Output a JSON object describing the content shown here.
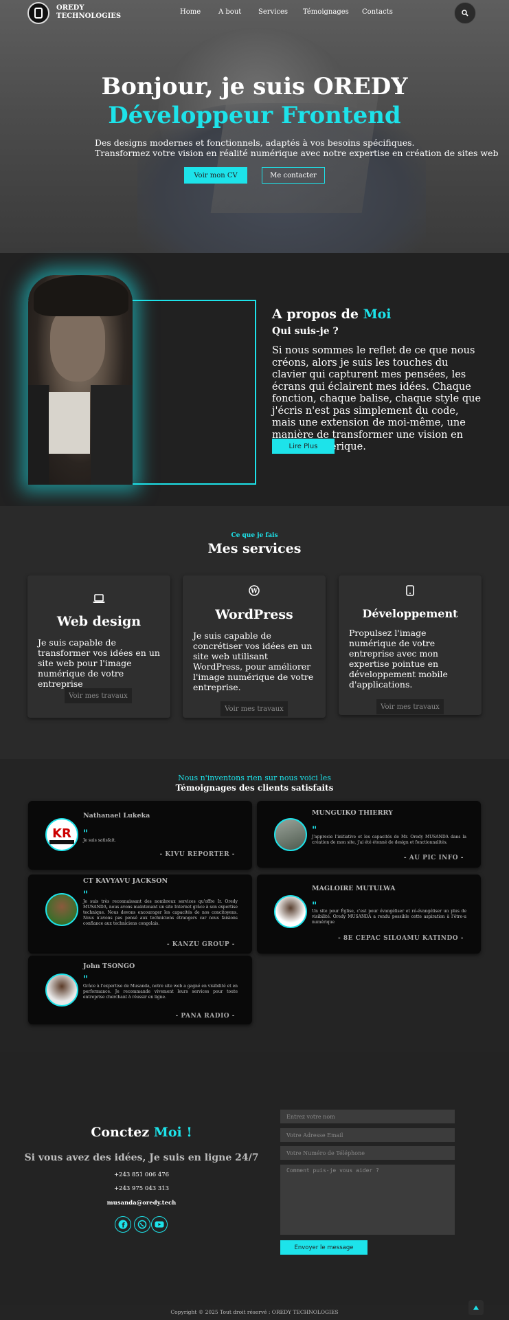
{
  "header": {
    "logo_text_line1": "OREDY",
    "logo_text_line2": "TECHNOLOGIES",
    "nav": [
      "Home",
      "A bout",
      "Services",
      "Témoignages",
      "Contacts"
    ]
  },
  "hero": {
    "greeting": "Bonjour, je suis OREDY",
    "role": "Développeur Frontend",
    "line1": "Des designs modernes et fonctionnels, adaptés à vos besoins spécifiques.",
    "line2": "Transformez votre vision en réalité numérique avec notre expertise en création de sites web",
    "btn_cv": "Voir mon CV",
    "btn_contact": "Me contacter"
  },
  "about": {
    "title_prefix": "A propos de",
    "title_accent": "Moi",
    "subtitle": "Qui suis-je ?",
    "text": "Si nous sommes le reflet de ce que nous créons, alors je suis les touches du clavier qui capturent mes pensées, les écrans qui éclairent mes idées. Chaque fonction, chaque balise, chaque style que j'écris n'est pas simplement du code, mais une extension de moi-même, une manière de transformer une vision en réalité numérique.",
    "button": "Lire Plus"
  },
  "services": {
    "kicker": "Ce que je fais",
    "title": "Mes services",
    "cards": [
      {
        "icon": "laptop-icon",
        "title": "Web design",
        "desc": "Je suis capable de transformer vos idées en un site web pour l'image numérique de votre entreprise",
        "button": "Voir mes travaux"
      },
      {
        "icon": "wordpress-icon",
        "title": "WordPress",
        "desc": "Je suis capable de concrétiser vos idées en un site web utilisant WordPress, pour améliorer l'image numérique de votre entreprise.",
        "button": "Voir mes travaux"
      },
      {
        "icon": "mobile-icon",
        "title": "Développement",
        "desc": "Propulsez l'image numérique de votre entreprise avec mon expertise pointue en développement mobile d'applications.",
        "button": "Voir mes travaux"
      }
    ]
  },
  "testimonials": {
    "kicker": "Nous n'inventons rien sur nous voici les",
    "title": "Témoignages des clients satisfaits",
    "items": [
      {
        "name": "Nathanael Lukeka",
        "text": "Je suis satisfait.",
        "company": "- KIVU REPORTER -"
      },
      {
        "name": "MUNGUIKO THIERRY",
        "text": "J'apprecie l'initiative et les capacités de Mr. Oredy MUSANDA dans la création de mon site, j'ai été étonné de design et fonctionnalités.",
        "company": "- AU PIC INFO -"
      },
      {
        "name": "CT KAVYAVU JACKSON",
        "text": "Je suis très reconnaissant des nombreux services qu'offre Ir. Oredy MUSANDA, nous avons maintenant un site Internet grâce à son expertise technique. Nous devons encourager les capacités de nos concitoyens. Nous n'avons pas pensé aux techniciens étrangers car nous faisions confiance aux techniciens congolais.",
        "company": "- KANZU GROUP -"
      },
      {
        "name": "MAGLOIRE MUTULWA",
        "text": "Un site pour Église, c'est pour évangéliser et ré-évangéliser un plus de visibilité. Oredy MUSANDA a rendu possible cette aspiration à l'être-u numérique",
        "company": "- 8E CEPAC SILOAMU KATINDO -"
      },
      {
        "name": "John TSONGO",
        "text": "Grâce à l'expertise de Musanda, notre site web a gagné en visibilité et en performance. Je recommande vivement leurs services pour toute entreprise cherchant à réussir en ligne.",
        "company": "- PANA RADIO -"
      }
    ],
    "logo_text": "KIVU REPORTER"
  },
  "contact": {
    "title_prefix": "Conctez",
    "title_accent": "Moi !",
    "subtitle": "Si vous avez des idées, Je suis en ligne 24/7",
    "phone1": "+243 851 006 476",
    "phone2": "+243 975 043 313",
    "email": "musanda@oredy.tech",
    "placeholders": {
      "name": "Entrez votre nom",
      "email": "Votre Adresse Email",
      "phone": "Votre Numéro de Téléphone",
      "message": "Comment puis-je vous aider ?"
    },
    "send": "Envoyer le message",
    "social": [
      "facebook-icon",
      "whatsapp-icon",
      "youtube-icon"
    ]
  },
  "footer": {
    "copyright": "Copyright © 2025 Tout droit réservé : OREDY TECHNOLOGIES"
  },
  "colors": {
    "accent": "#1de3ea",
    "background": "#242424"
  }
}
